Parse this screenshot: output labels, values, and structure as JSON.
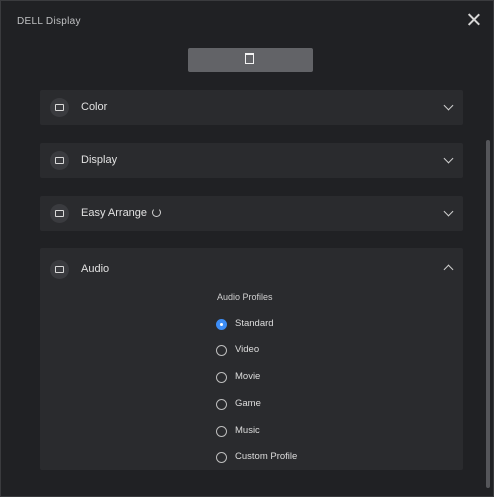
{
  "window": {
    "title": "DELL Display"
  },
  "monitor_tab": {
    "icon": "monitor-icon"
  },
  "sections": [
    {
      "label": "Color",
      "icon": "color-icon",
      "expanded": false
    },
    {
      "label": "Display",
      "icon": "display-icon",
      "expanded": false
    },
    {
      "label": "Easy Arrange",
      "icon": "easy-arrange-icon",
      "expanded": false
    },
    {
      "label": "Audio",
      "icon": "audio-icon",
      "expanded": true
    }
  ],
  "audio": {
    "group_label": "Audio Profiles",
    "options": [
      {
        "label": "Standard",
        "selected": true
      },
      {
        "label": "Video",
        "selected": false
      },
      {
        "label": "Movie",
        "selected": false
      },
      {
        "label": "Game",
        "selected": false
      },
      {
        "label": "Music",
        "selected": false
      },
      {
        "label": "Custom Profile",
        "selected": false
      }
    ]
  }
}
